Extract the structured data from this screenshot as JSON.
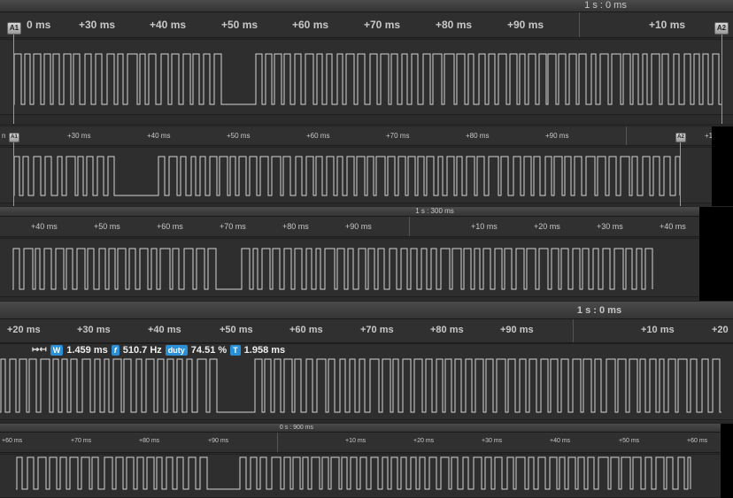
{
  "panels": [
    {
      "id": "top",
      "center_label": "1 s : 0 ms",
      "ticks": [
        "0 ms",
        "+30 ms",
        "+40 ms",
        "+50 ms",
        "+60 ms",
        "+70 ms",
        "+80 ms",
        "+90 ms",
        "+10 ms"
      ],
      "cursors": [
        "A1",
        "A2"
      ]
    },
    {
      "id": "second",
      "center_label": "",
      "ticks": [
        "n",
        "+30 ms",
        "+40 ms",
        "+50 ms",
        "+60 ms",
        "+70 ms",
        "+80 ms",
        "+90 ms",
        "+1"
      ],
      "cursors": [
        "A1",
        "A2"
      ]
    },
    {
      "id": "third",
      "center_label": "1 s : 300 ms",
      "ticks": [
        "+40 ms",
        "+50 ms",
        "+60 ms",
        "+70 ms",
        "+80 ms",
        "+90 ms",
        "+10 ms",
        "+20 ms",
        "+30 ms",
        "+40 ms"
      ]
    },
    {
      "id": "fourth",
      "center_label": "1 s : 0 ms",
      "ticks": [
        "+20 ms",
        "+30 ms",
        "+40 ms",
        "+50 ms",
        "+60 ms",
        "+70 ms",
        "+80 ms",
        "+90 ms",
        "+10 ms",
        "+20"
      ]
    },
    {
      "id": "fifth",
      "center_label": "0 s : 900 ms",
      "ticks": [
        "+60 ms",
        "+70 ms",
        "+80 ms",
        "+90 ms",
        "+10 ms",
        "+20 ms",
        "+30 ms",
        "+40 ms",
        "+50 ms",
        "+60 ms"
      ]
    }
  ],
  "measurement": {
    "width_badge": "W",
    "width_value": "1.459 ms",
    "freq_badge": "f",
    "freq_value": "510.7 Hz",
    "duty_badge": "duty",
    "duty_value": "74.51 %",
    "period_badge": "T",
    "period_value": "1.958 ms"
  }
}
